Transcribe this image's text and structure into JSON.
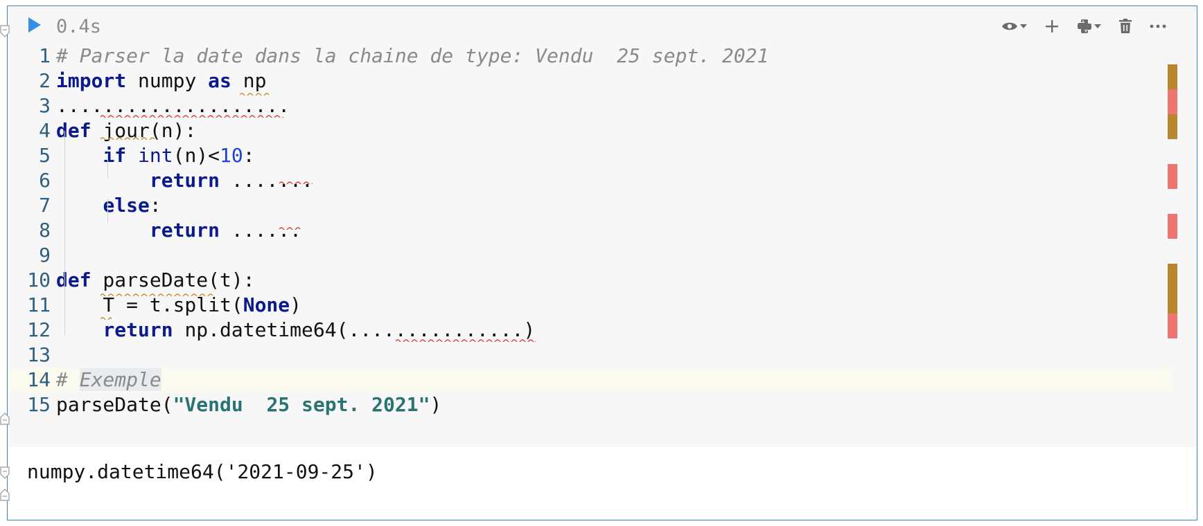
{
  "cell": {
    "exec_time": "0.4s",
    "toolbar": {
      "icons": [
        "eye-icon",
        "plus-icon",
        "python-icon",
        "trash-icon",
        "more-icon"
      ]
    },
    "lines": [
      {
        "n": "1",
        "tokens": [
          {
            "t": "# Parser la date dans la chaine de type: Vendu  25 sept. 2021",
            "c": "cmt"
          }
        ]
      },
      {
        "n": "2",
        "tokens": [
          {
            "t": "import",
            "c": "kw"
          },
          {
            "t": " numpy ",
            "c": ""
          },
          {
            "t": "as",
            "c": "kw"
          },
          {
            "t": " np",
            "c": ""
          }
        ]
      },
      {
        "n": "3",
        "tokens": [
          {
            "t": "....................",
            "c": ""
          }
        ]
      },
      {
        "n": "4",
        "tokens": [
          {
            "t": "def",
            "c": "kw"
          },
          {
            "t": " jour(n):",
            "c": ""
          }
        ]
      },
      {
        "n": "5",
        "tokens": [
          {
            "t": "    ",
            "c": ""
          },
          {
            "t": "if",
            "c": "kw"
          },
          {
            "t": " ",
            "c": ""
          },
          {
            "t": "int",
            "c": "bi"
          },
          {
            "t": "(n)<",
            "c": ""
          },
          {
            "t": "10",
            "c": "num"
          },
          {
            "t": ":",
            "c": ""
          }
        ]
      },
      {
        "n": "6",
        "tokens": [
          {
            "t": "        ",
            "c": ""
          },
          {
            "t": "return",
            "c": "kw"
          },
          {
            "t": " .......",
            "c": ""
          }
        ]
      },
      {
        "n": "7",
        "tokens": [
          {
            "t": "    ",
            "c": ""
          },
          {
            "t": "else",
            "c": "kw"
          },
          {
            "t": ":",
            "c": ""
          }
        ]
      },
      {
        "n": "8",
        "tokens": [
          {
            "t": "        ",
            "c": ""
          },
          {
            "t": "return",
            "c": "kw"
          },
          {
            "t": " ......",
            "c": ""
          }
        ]
      },
      {
        "n": "9",
        "tokens": []
      },
      {
        "n": "10",
        "tokens": [
          {
            "t": "def",
            "c": "kw"
          },
          {
            "t": " parseDate(t):",
            "c": ""
          }
        ]
      },
      {
        "n": "11",
        "tokens": [
          {
            "t": "    T = t.split(",
            "c": ""
          },
          {
            "t": "None",
            "c": "kw"
          },
          {
            "t": ")",
            "c": ""
          }
        ]
      },
      {
        "n": "12",
        "tokens": [
          {
            "t": "    ",
            "c": ""
          },
          {
            "t": "return",
            "c": "kw"
          },
          {
            "t": " np.datetime64(...............)",
            "c": ""
          }
        ]
      },
      {
        "n": "13",
        "tokens": []
      },
      {
        "n": "14",
        "tokens": [
          {
            "t": "# ",
            "c": "cmt"
          },
          {
            "t": "Exemple",
            "c": "cmt hl"
          }
        ]
      },
      {
        "n": "15",
        "tokens": [
          {
            "t": "parseDate(",
            "c": ""
          },
          {
            "t": "\"Vendu  25 sept. 2021\"",
            "c": "str"
          },
          {
            "t": ")",
            "c": ""
          }
        ]
      }
    ],
    "output": "numpy.datetime64('2021-09-25')",
    "colors": {
      "accent": "#3a8ee6",
      "warning_marker": "#b8862c",
      "error_marker": "#ee7570",
      "border": "#3f86b8"
    }
  }
}
